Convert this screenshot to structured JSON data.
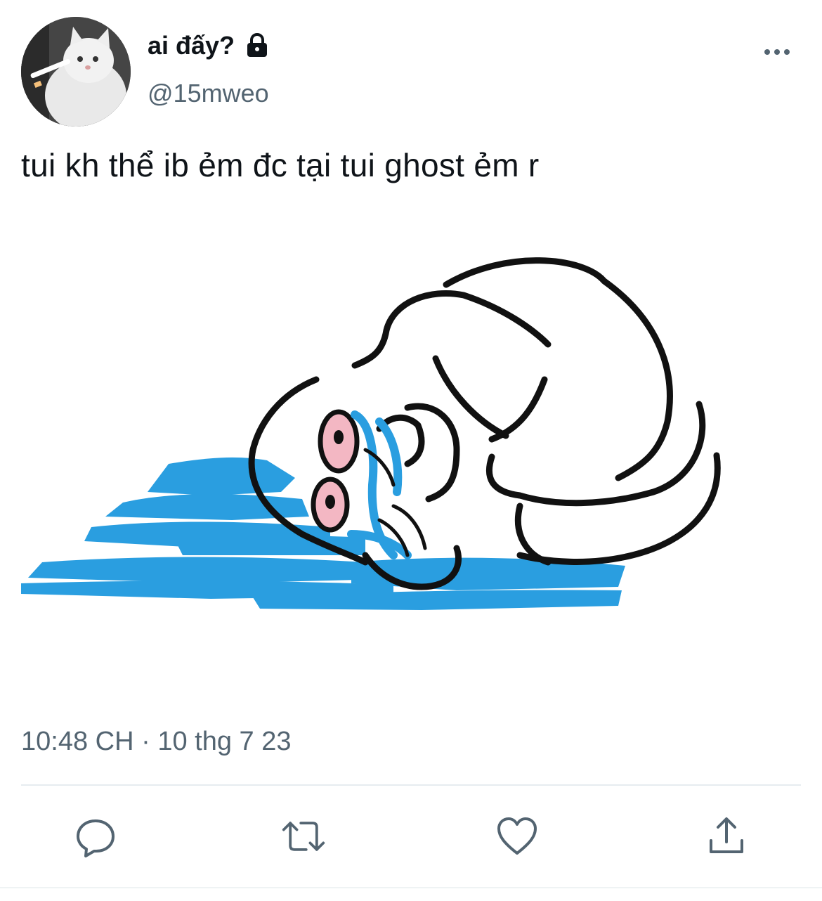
{
  "tweet": {
    "display_name": "ai đấy?",
    "handle": "@15mweo",
    "text": "tui kh thể ib ẻm đc tại tui ghost ẻm r",
    "time": "10:48 CH",
    "separator": " · ",
    "date": "10 thg 7 23"
  },
  "icons": {
    "account_protected": "lock-icon",
    "more": "more-horizontal-icon",
    "reply": "reply-icon",
    "retweet": "retweet-icon",
    "like": "heart-icon",
    "share": "share-icon"
  },
  "colors": {
    "text_primary": "#0f1419",
    "text_secondary": "#536471",
    "icon_gray": "#536471",
    "tear_blue": "#2a9ee0"
  }
}
